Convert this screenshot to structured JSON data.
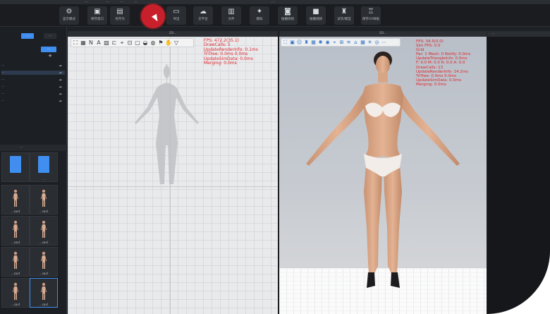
{
  "menubar": {
    "items": [
      "…",
      "…",
      "…",
      "…"
    ],
    "center": "…"
  },
  "toolbar": {
    "buttons": [
      {
        "label": "显示模式",
        "icon": "gear-icon"
      },
      {
        "label": "保存窗口",
        "icon": "window-icon"
      },
      {
        "label": "另存为",
        "icon": "save-icon"
      },
      {
        "label": "…",
        "icon": "record-icon"
      },
      {
        "label": "导出",
        "icon": "folder-icon"
      },
      {
        "label": "云平台",
        "icon": "cloud-icon"
      },
      {
        "label": "文件",
        "icon": "file-icon"
      },
      {
        "label": "模拟",
        "icon": "simulate-icon"
      },
      {
        "label": "拍摄快照",
        "icon": "camera-icon"
      },
      {
        "label": "拍摄视频",
        "icon": "video-icon"
      },
      {
        "label": "试衣/模型",
        "icon": "tshirt-icon"
      },
      {
        "label": "保存UV样板",
        "icon": "shirt-icon"
      }
    ]
  },
  "left_panel": {
    "tab_active": "…",
    "tab_inactive": "…",
    "subtab": "…",
    "tree": [
      "…",
      "…",
      "…",
      "…",
      "…",
      "…"
    ],
    "library_title": "…",
    "thumbs": [
      {
        "caption": "",
        "type": "folder"
      },
      {
        "caption": "…",
        "type": "folder"
      },
      {
        "caption": "…savt",
        "type": "avatar"
      },
      {
        "caption": "…savt",
        "type": "avatar"
      },
      {
        "caption": "…savt",
        "type": "avatar"
      },
      {
        "caption": "…savt",
        "type": "avatar"
      },
      {
        "caption": "…savt",
        "type": "avatar"
      },
      {
        "caption": "…savt",
        "type": "avatar"
      },
      {
        "caption": "…savt",
        "type": "avatar"
      },
      {
        "caption": "…savt",
        "type": "avatar"
      }
    ]
  },
  "panel2d": {
    "title": "2D…",
    "stats": "FPS: 472.2(35.1)\nDrawCalls: 5\nUpdateRenderInfo: 0.1ms\nTriTree: 0.0ms 0.0ms\nUpdateSimData: 0.0ms\nMerging: 0.0ms"
  },
  "panel3d": {
    "title": "3D…",
    "stats": "FPS: 34.5(0.0)\nSim FPS: 0.0\nGrid\nPar: 1 Mesh: 0 Notify: 0.0ms\nUpdateTriangleInfo: 0.0ms\nF: 0.0 M: 0.0 R: 0.0 A: 0.0\nDrawCalls: 13\nUpdateRenderInfo: 14.2ms\nTriTree: 0.0ms 0.0ms\nUpdateSimData: 0.0ms\nMerging: 0.0ms"
  },
  "right_panel": {
    "title": "…"
  },
  "colors": {
    "accent": "#3f8ef0",
    "record": "#c8202a",
    "stats": "#e0262d"
  }
}
